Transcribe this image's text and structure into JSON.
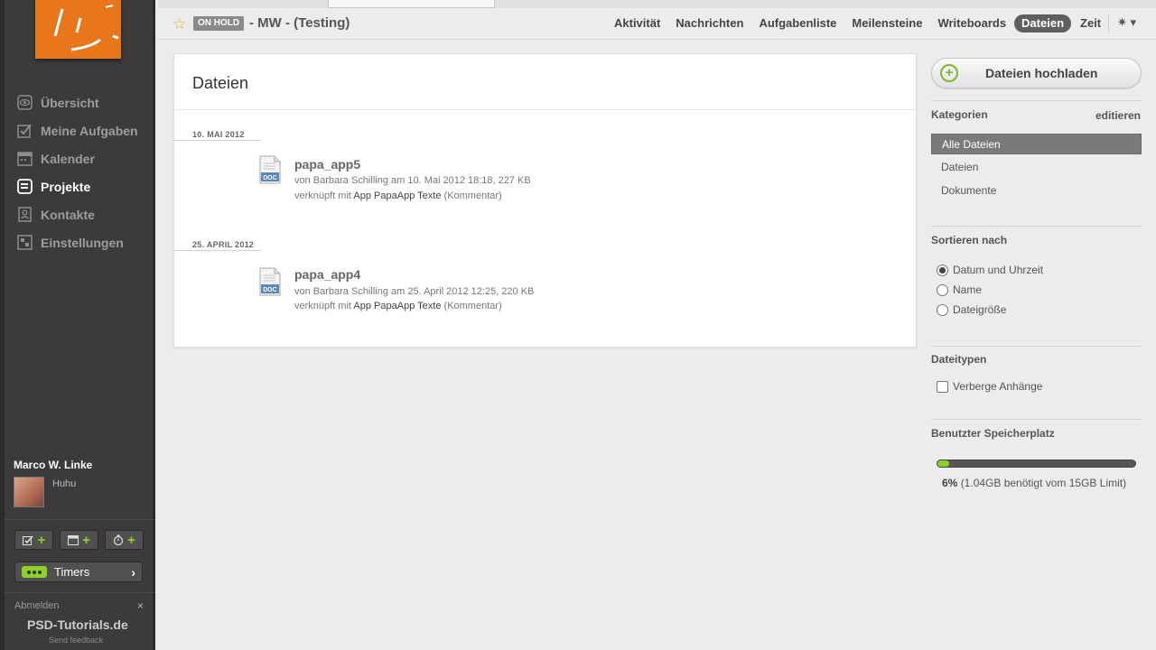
{
  "sidebar": {
    "nav": [
      {
        "label": "Übersicht",
        "icon": "eye-icon",
        "active": false
      },
      {
        "label": "Meine Aufgaben",
        "icon": "checkbox-icon",
        "active": false
      },
      {
        "label": "Kalender",
        "icon": "calendar-icon",
        "active": false
      },
      {
        "label": "Projekte",
        "icon": "folder-icon",
        "active": true
      },
      {
        "label": "Kontakte",
        "icon": "contacts-icon",
        "active": false
      },
      {
        "label": "Einstellungen",
        "icon": "settings-icon",
        "active": false
      }
    ],
    "user_name": "Marco W. Linke",
    "user_status": "Huhu",
    "timers_label": "Timers",
    "logout_label": "Abmelden",
    "close_symbol": "×",
    "feedback_label": "Send feedback",
    "watermark": "PSD-Tutorials.de"
  },
  "header": {
    "status_badge": "ON HOLD",
    "project_title": "- MW - (Testing)",
    "tabs": [
      {
        "label": "Aktivität",
        "active": false
      },
      {
        "label": "Nachrichten",
        "active": false
      },
      {
        "label": "Aufgabenliste",
        "active": false
      },
      {
        "label": "Meilensteine",
        "active": false
      },
      {
        "label": "Writeboards",
        "active": false
      },
      {
        "label": "Dateien",
        "active": true
      },
      {
        "label": "Zeit",
        "active": false
      }
    ],
    "gear_symbol": "✷ ▾"
  },
  "main": {
    "title": "Dateien",
    "groups": [
      {
        "date": "10. MAI 2012",
        "files": [
          {
            "name": "papa_app5",
            "meta": "von Barbara Schilling am 10. Mai 2012 18:18, 227 KB",
            "link_prefix": "verknüpft mit",
            "link_target": "App PapaApp Texte",
            "link_suffix": "(Kommentar)"
          }
        ]
      },
      {
        "date": "25. APRIL 2012",
        "files": [
          {
            "name": "papa_app4",
            "meta": "von Barbara Schilling am 25. April 2012 12:25, 220 KB",
            "link_prefix": "verknüpft mit",
            "link_target": "App PapaApp Texte",
            "link_suffix": "(Kommentar)"
          }
        ]
      }
    ],
    "file_type_label": "DOC"
  },
  "right": {
    "upload_label": "Dateien hochladen",
    "categories_title": "Kategorien",
    "edit_label": "editieren",
    "categories": [
      {
        "label": "Alle Dateien",
        "active": true
      },
      {
        "label": "Dateien",
        "active": false
      },
      {
        "label": "Dokumente",
        "active": false
      }
    ],
    "sort_title": "Sortieren nach",
    "sort_options": [
      {
        "label": "Datum und Uhrzeit",
        "selected": true
      },
      {
        "label": "Name",
        "selected": false
      },
      {
        "label": "Dateigröße",
        "selected": false
      }
    ],
    "filetypes_title": "Dateitypen",
    "hide_attachments_label": "Verberge Anhänge",
    "hide_attachments_checked": false,
    "storage_title": "Benutzter Speicherplatz",
    "storage_percent": "6%",
    "storage_detail": "(1.04GB benötigt vom 15GB Limit)",
    "storage_fraction": 0.06
  },
  "colors": {
    "accent_green": "#8fd12b",
    "logo_orange": "#e8761a",
    "sidebar_bg": "#3b3b3b"
  }
}
